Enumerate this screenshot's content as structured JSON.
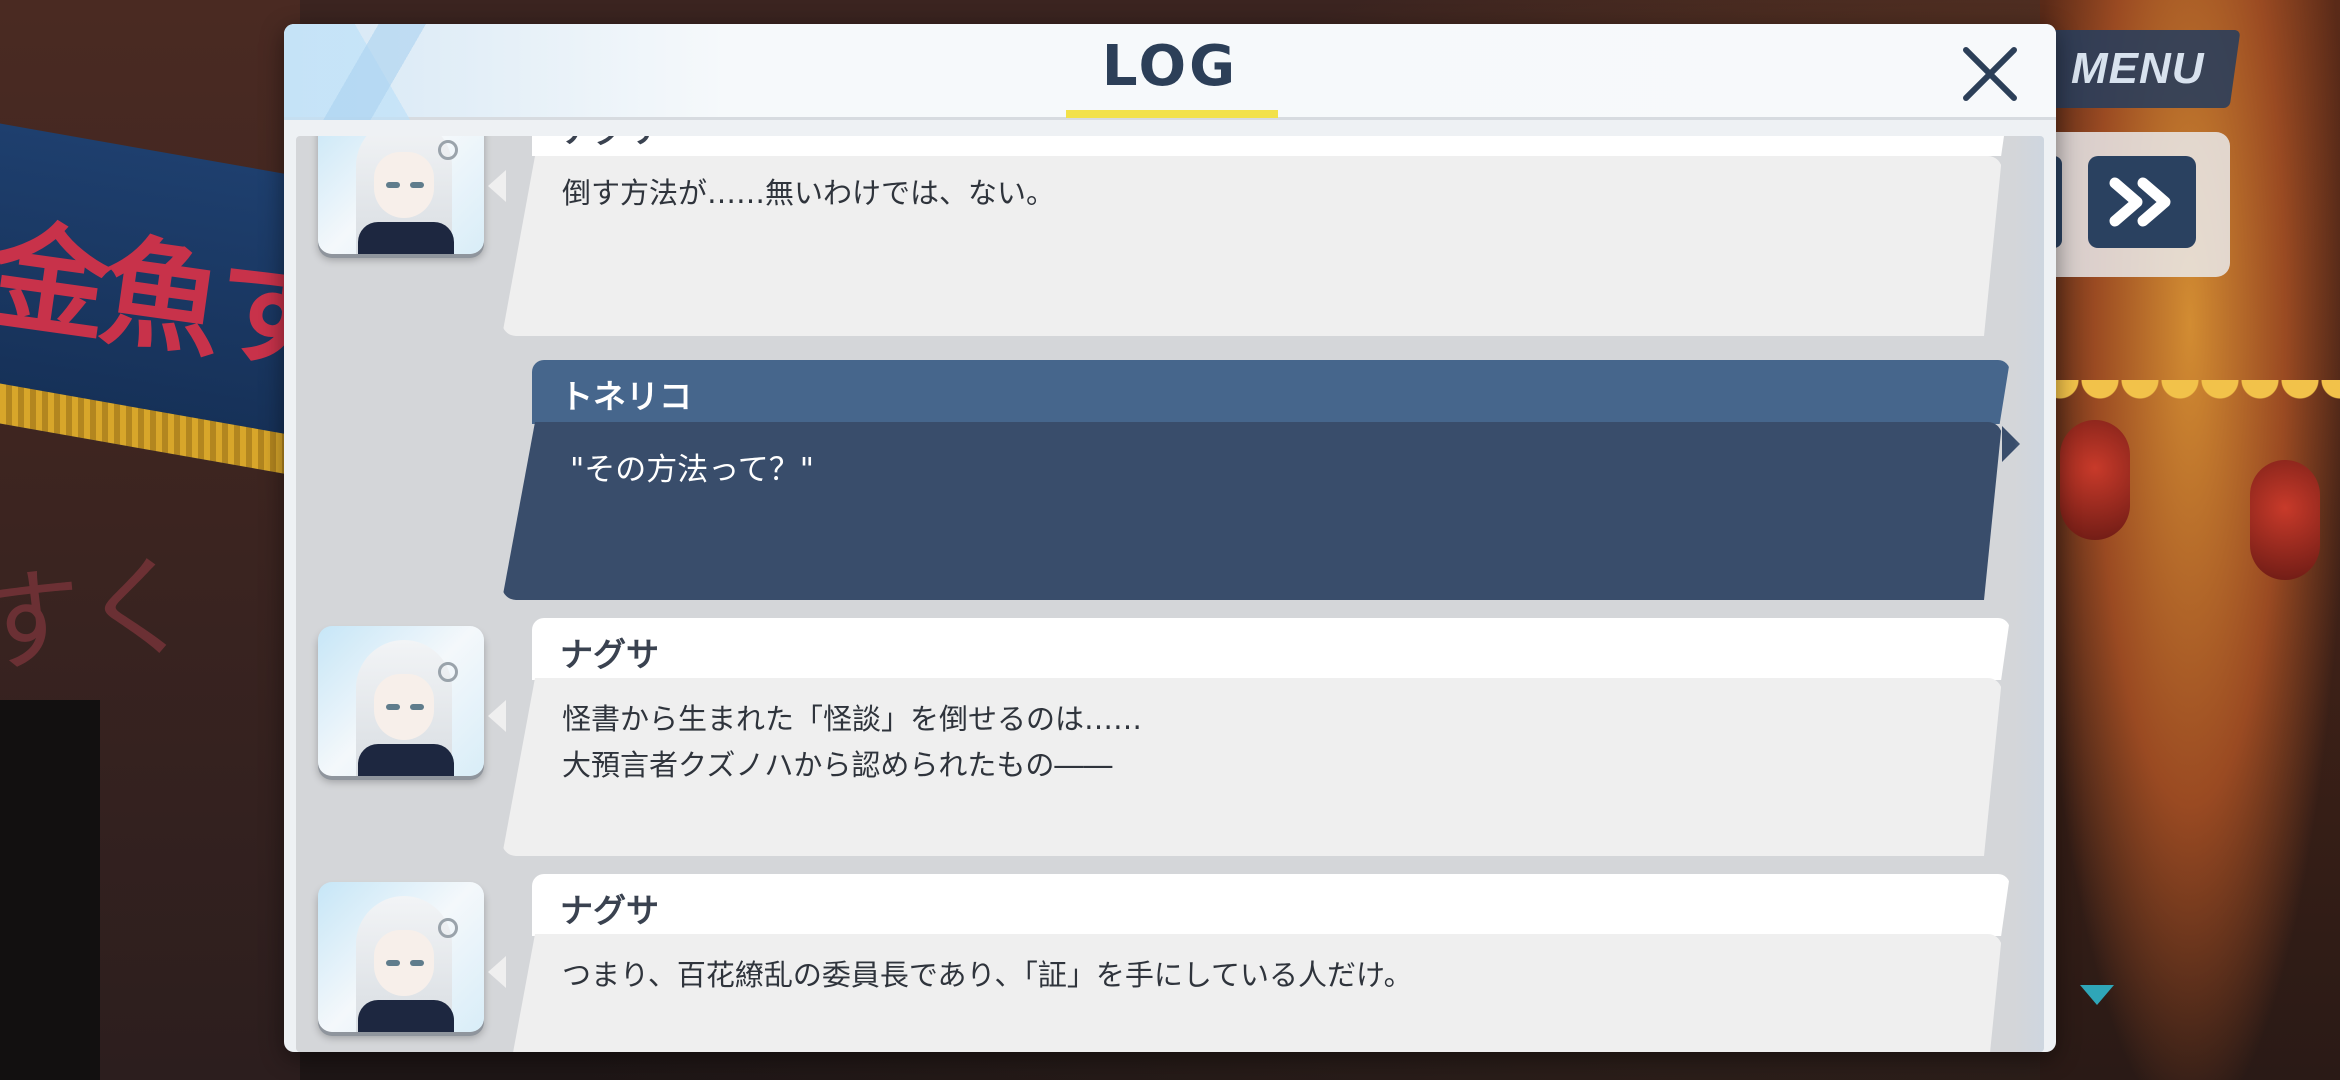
{
  "hud": {
    "menu_label": "MENU",
    "skip_icon": "double-chevron-right-icon",
    "scroll_indicator_icon": "triangle-down-icon",
    "accent_color": "#2fa6b8"
  },
  "log": {
    "title": "LOG",
    "close_icon": "close-x-icon",
    "underline_color": "#f2e14a",
    "entries": [
      {
        "speaker": "ナグサ",
        "text": "倒す方法が……無いわけでは、ない。",
        "side": "left"
      },
      {
        "speaker": "トネリコ",
        "text": "\"その方法って？\"",
        "side": "player"
      },
      {
        "speaker": "ナグサ",
        "text": "怪書から生まれた「怪談」を倒せるのは……\n大預言者クズノハから認められたもの――",
        "side": "left"
      },
      {
        "speaker": "ナグサ",
        "text": "つまり、百花繚乱の委員長であり、「証」を手にしている人だけ。",
        "side": "left"
      }
    ]
  }
}
